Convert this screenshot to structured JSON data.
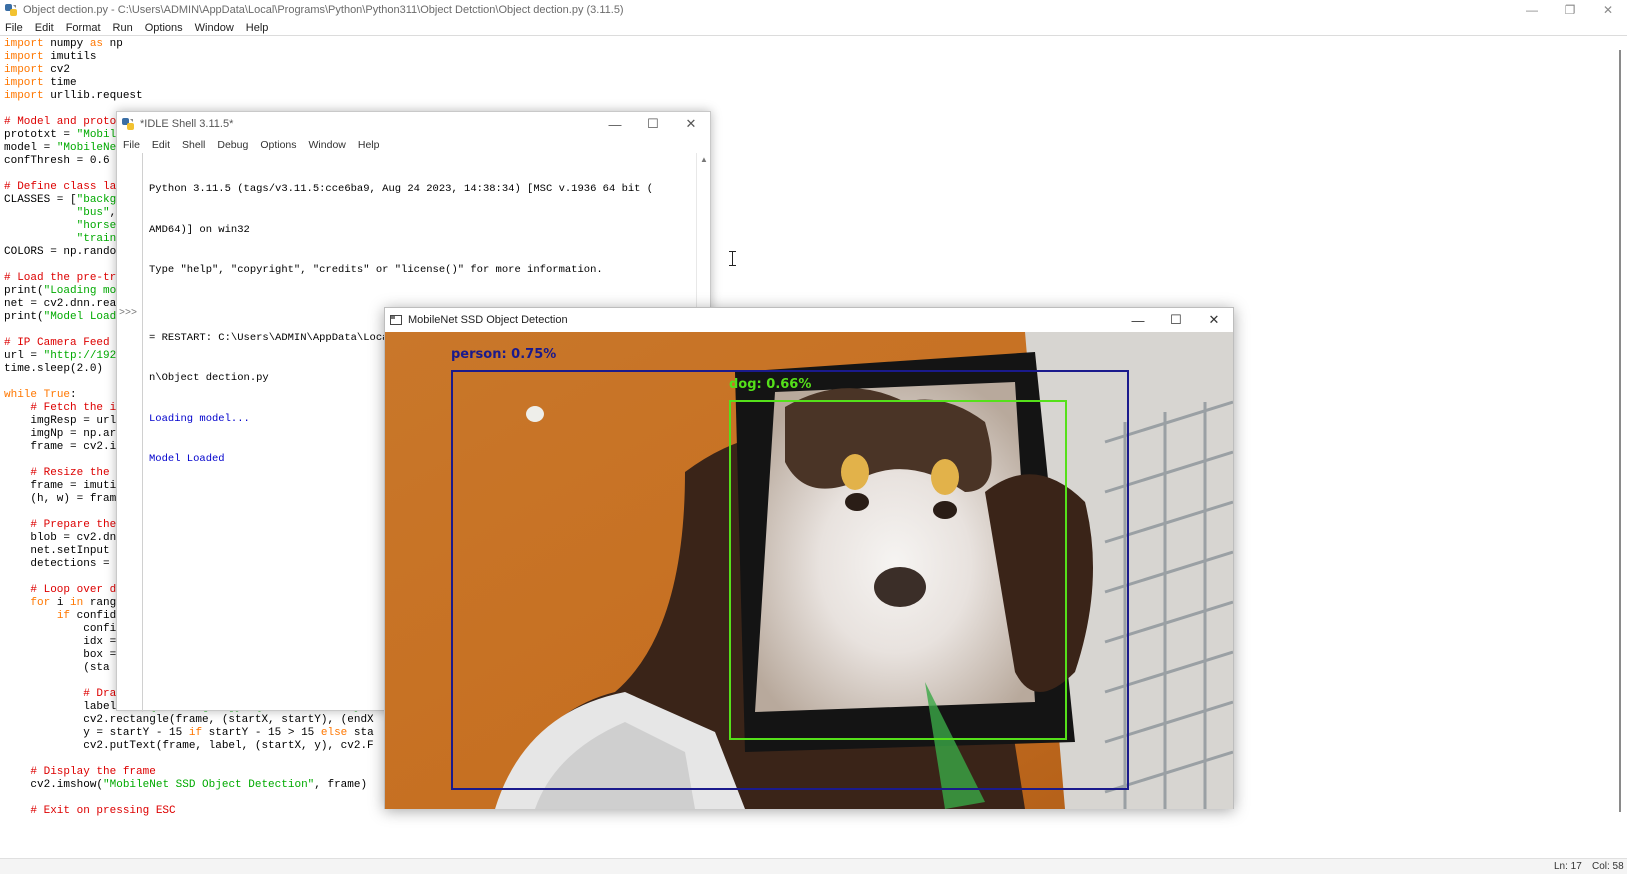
{
  "editor": {
    "title": "Object dection.py - C:\\Users\\ADMIN\\AppData\\Local\\Programs\\Python\\Python311\\Object Detction\\Object dection.py (3.11.5)",
    "menu": [
      "File",
      "Edit",
      "Format",
      "Run",
      "Options",
      "Window",
      "Help"
    ],
    "status": {
      "line": "Ln: 17",
      "col": "Col: 58"
    },
    "code_lines": [
      "import numpy as np",
      "import imutils",
      "import cv2",
      "import time",
      "import urllib.request",
      "",
      "# Model and proto",
      "prototxt = \"Mobil",
      "model = \"MobileNe",
      "confThresh = 0.6",
      "",
      "# Define class la",
      "CLASSES = [\"backg",
      "           \"bus\",",
      "           \"horse",
      "           \"train",
      "COLORS = np.rando",
      "",
      "# Load the pre-tr",
      "print(\"Loading mo",
      "net = cv2.dnn.rea",
      "print(\"Model Load",
      "",
      "# IP Camera Feed",
      "url = \"http://192",
      "time.sleep(2.0)",
      "",
      "while True:",
      "    # Fetch the i",
      "    imgResp = url",
      "    imgNp = np.ar",
      "    frame = cv2.i",
      "",
      "    # Resize the",
      "    frame = imuti",
      "    (h, w) = fram",
      "",
      "    # Prepare the",
      "    blob = cv2.dn",
      "    net.setInput",
      "    detections =",
      "",
      "    # Loop over d",
      "    for i in rang",
      "        if confid",
      "            confiden",
      "            idx =",
      "            box =",
      "            (sta",
      "",
      "            # Draw the prediction",
      "            label = f\"{CLASSES[idx]}: {confidence:.2f}%\"",
      "            cv2.rectangle(frame, (startX, startY), (endX",
      "            y = startY - 15 if startY - 15 > 15 else sta",
      "            cv2.putText(frame, label, (startX, y), cv2.F",
      "",
      "    # Display the frame",
      "    cv2.imshow(\"MobileNet SSD Object Detection\", frame)",
      "",
      "    # Exit on pressing ESC"
    ]
  },
  "shell": {
    "title": "*IDLE Shell 3.11.5*",
    "menu": [
      "File",
      "Edit",
      "Shell",
      "Debug",
      "Options",
      "Window",
      "Help"
    ],
    "prompt": ">>>",
    "lines": [
      "Python 3.11.5 (tags/v3.11.5:cce6ba9, Aug 24 2023, 14:38:34) [MSC v.1936 64 bit (",
      "AMD64)] on win32",
      "Type \"help\", \"copyright\", \"credits\" or \"license()\" for more information.",
      "",
      "= RESTART: C:\\Users\\ADMIN\\AppData\\Local\\Programs\\Python\\Python311\\Object Detctio",
      "n\\Object dection.py"
    ],
    "output": [
      "Loading model...",
      "Model Loaded"
    ]
  },
  "mobilenet": {
    "title": "MobileNet SSD Object Detection",
    "detections": [
      {
        "label": "person: 0.75%",
        "color": "#1a1a8c"
      },
      {
        "label": "dog: 0.66%",
        "color": "#55e01a"
      }
    ]
  },
  "icons": {
    "app": "python-idle-icon",
    "minimize": "minimize-icon",
    "maximize": "maximize-icon",
    "close": "close-icon",
    "opencv_window": "window-app-icon"
  }
}
